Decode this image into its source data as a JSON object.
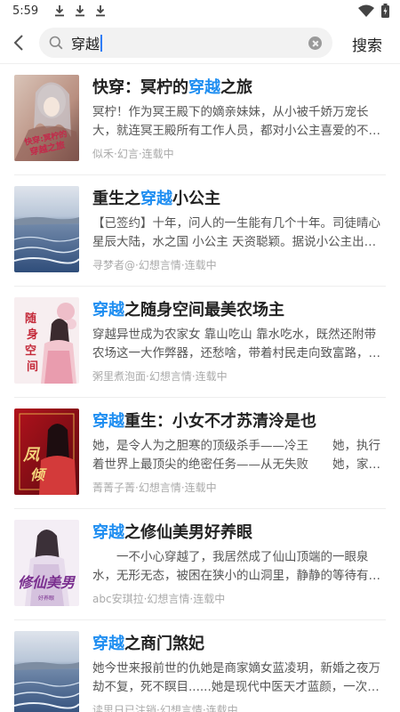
{
  "status_bar": {
    "time": "5:59",
    "icons": [
      "download-icon",
      "download-icon",
      "download-icon",
      "wifi-icon",
      "battery-icon"
    ]
  },
  "search": {
    "query": "穿越",
    "submit_label": "搜索"
  },
  "colors": {
    "highlight": "#1f8ef1",
    "meta": "#aaaaaa"
  },
  "results": [
    {
      "title_pre": "快穿：冥柠的",
      "title_hl": "穿越",
      "title_post": "之旅",
      "desc": "冥柠！作为冥王殿下的嫡亲妹妹，从小被千娇万宠长大，就连冥王殿所有工作人员，都对小公主喜爱的不得了，...",
      "meta": "似禾·幻言·连载中",
      "cover_text": "快穿:冥柠的穿越之旅"
    },
    {
      "title_pre": "重生之",
      "title_hl": "穿越",
      "title_post": "小公主",
      "desc": "【已签约】十年，问人的一生能有几个十年。司徒晴心星辰大陆，水之国 小公主 天资聪颖。据说小公主出生之...",
      "meta": "寻梦者@·幻想言情·连载中",
      "cover_text": ""
    },
    {
      "title_pre": "",
      "title_hl": "穿越",
      "title_post": "之随身空间最美农场主",
      "desc": "穿越异世成为农家女 靠山吃山 靠水吃水，既然还附带农场这一大作弊器，还愁啥，带着村民走向致富路，带着...",
      "meta": "粥里煮泡面·幻想言情·连载中",
      "cover_text": "随身空间"
    },
    {
      "title_pre": "",
      "title_hl": "穿越",
      "title_post": "重生：小女不才苏清泠是也",
      "desc": "她，是令人为之胆寒的顶级杀手——冷王　　她，执行着世界上最顶尖的绝密任务——从无失败　　她，家世显赫...",
      "meta": "菁菁子菁·幻想言情·连载中",
      "cover_text": "凤倾天下"
    },
    {
      "title_pre": "",
      "title_hl": "穿越",
      "title_post": "之修仙美男好养眼",
      "desc": "　　一不小心穿越了，我居然成了仙山顶端的一眼泉水，无形无态，被困在狭小的山洞里，静静的等待有缘者的...",
      "meta": "abc安琪拉·幻想言情·连载中",
      "cover_text": "修仙美男"
    },
    {
      "title_pre": "",
      "title_hl": "穿越",
      "title_post": "之商门煞妃",
      "desc": "她今世来报前世的仇她是商家嫡女蓝凌玥，新婚之夜万劫不复，死不瞑目......她是现代中医天才蓝颜，一次宿命召...",
      "meta": "读思日已注销·幻想言情·连载中",
      "cover_text": ""
    }
  ]
}
